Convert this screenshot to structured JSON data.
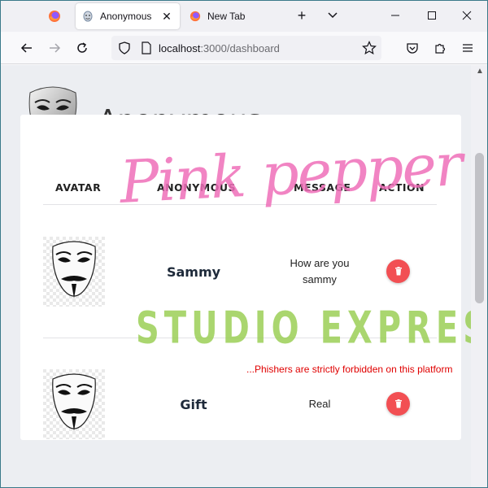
{
  "browser": {
    "tabs": [
      {
        "label": "Anonymous",
        "active": true
      },
      {
        "label": "New Tab",
        "active": false
      }
    ],
    "close_glyph": "✕",
    "newtab_glyph": "+",
    "url": {
      "host": "localhost",
      "path": ":3000/dashboard"
    }
  },
  "page": {
    "title": "Anonymous",
    "table": {
      "columns": [
        "AVATAR",
        "ANONYMOUS",
        "MESSAGE",
        "ACTION"
      ],
      "rows": [
        {
          "name": "Sammy",
          "message": "How are you sammy"
        },
        {
          "name": "Gift",
          "message": "Real"
        }
      ]
    },
    "notice": "...Phishers are strictly forbidden on this platform"
  },
  "watermark": {
    "line1": "Pink pepper",
    "line2": "STUDIO EXPRESS"
  },
  "colors": {
    "delete_button": "#f24f53",
    "notice_text": "#e00000",
    "watermark_pink": "#ef6fb9",
    "watermark_green": "#9ccf57"
  },
  "icons": {
    "delete": "trash-icon",
    "avatar": "guy-fawkes-mask"
  }
}
